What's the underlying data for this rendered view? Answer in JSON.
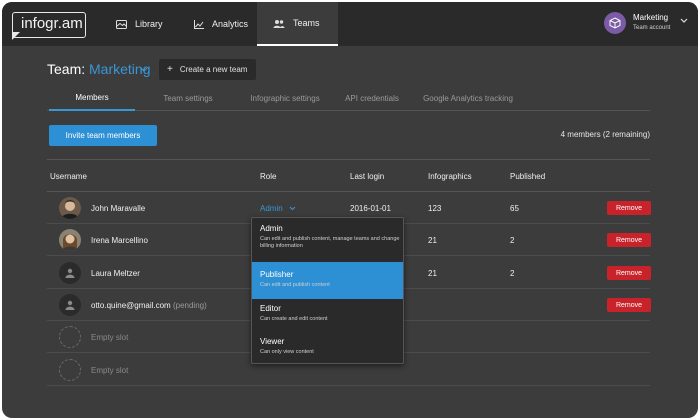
{
  "nav": {
    "logo": "infogr.am",
    "items": [
      {
        "label": "Library",
        "icon": "library-icon"
      },
      {
        "label": "Analytics",
        "icon": "analytics-icon"
      },
      {
        "label": "Teams",
        "icon": "teams-icon"
      }
    ],
    "account": {
      "name": "Marketing",
      "type": "Team account",
      "icon": "cube-icon"
    }
  },
  "team": {
    "prefix": "Team:",
    "name": "Marketing",
    "create_label": "Create a new team"
  },
  "tabs": [
    "Members",
    "Team settings",
    "Infographic settings",
    "API credentials",
    "Google Analytics tracking"
  ],
  "invite_label": "Invite team members",
  "members_count": "4 members (2 remaining)",
  "columns": [
    "Username",
    "Role",
    "Last login",
    "Infographics",
    "Published"
  ],
  "rows": [
    {
      "name": "John Maravalle",
      "role": "Admin",
      "last_login": "2016-01-01",
      "infographics": "123",
      "published": "65"
    },
    {
      "name": "Irena Marcellino",
      "role": "",
      "last_login": "",
      "infographics": "21",
      "published": "2"
    },
    {
      "name": "Laura Meltzer",
      "role": "",
      "last_login": "",
      "infographics": "21",
      "published": "2"
    },
    {
      "name": "otto.quine@gmail.com",
      "pending": "(pending)"
    }
  ],
  "empty_slot": "Empty slot",
  "remove_label": "Remove",
  "role_menu": [
    {
      "title": "Admin",
      "desc": "Can edit and publish content, manage teams and change billing information"
    },
    {
      "title": "Publisher",
      "desc": "Can edit and publish content"
    },
    {
      "title": "Editor",
      "desc": "Can create and edit content"
    },
    {
      "title": "Viewer",
      "desc": "Can only view content"
    }
  ],
  "colors": {
    "accent": "#2d8fd4",
    "danger": "#c8232a",
    "background": "#3c3c3c",
    "nav": "#2a2a2a"
  }
}
